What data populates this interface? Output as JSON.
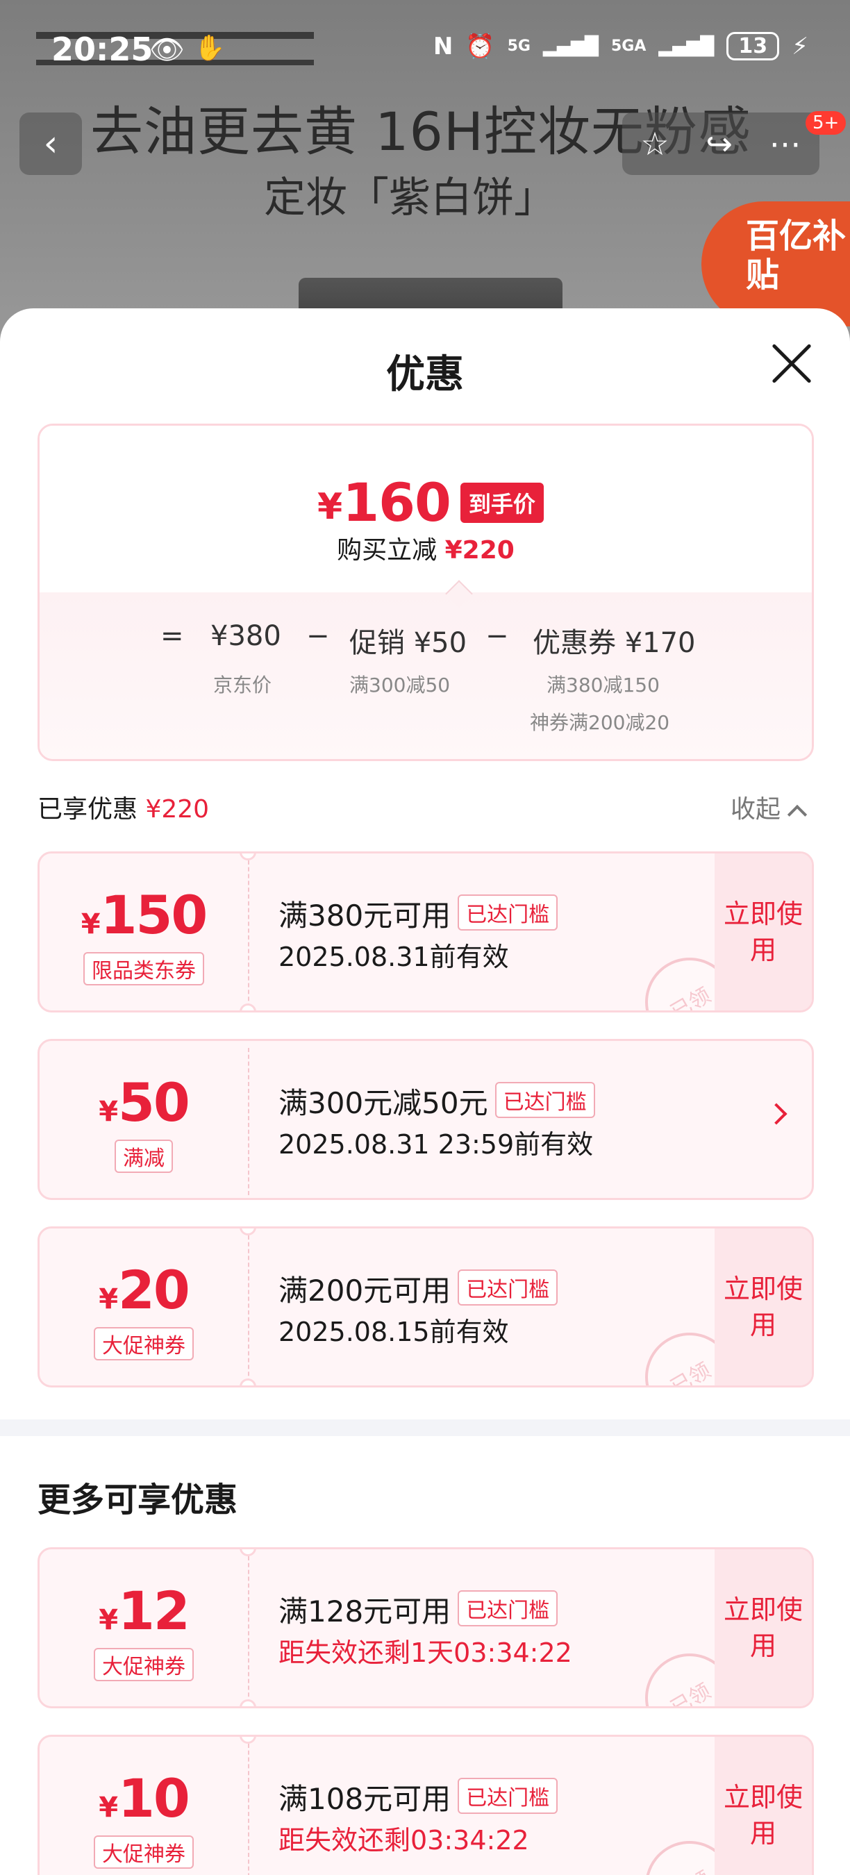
{
  "status_bar": {
    "time": "20:25",
    "signal1": "5G",
    "signal2": "5GA",
    "battery": "13"
  },
  "background": {
    "banner_title": "去油更去黄 16H控妆无粉感",
    "banner_subtitle": "定妆「紫白饼」",
    "subsidy_badge": "百亿补贴",
    "badge_count": "5+"
  },
  "sheet": {
    "title": "优惠",
    "summary": {
      "yen": "¥",
      "final_price": "160",
      "price_tag": "到手价",
      "instant_cut_label": "购买立减",
      "instant_cut_value": "¥220",
      "formula": {
        "equals": "=",
        "jd_price": "¥380",
        "jd_price_label": "京东价",
        "minus1": "−",
        "promo": "促销 ¥50",
        "promo_detail": "满300减50",
        "minus2": "−",
        "coupon": "优惠券 ¥170",
        "coupon_detail1": "满380减150",
        "coupon_detail2": "神券满200减20"
      }
    },
    "enjoyed_label": "已享优惠",
    "enjoyed_value": "¥220",
    "collapse_label": "收起",
    "coupons": [
      {
        "yen": "¥",
        "amount": "150",
        "type": "限品类东券",
        "condition": "满380元可用",
        "threshold": "已达门槛",
        "validity": "2025.08.31前有效",
        "action": "立即使用",
        "stamp": "已领"
      },
      {
        "yen": "¥",
        "amount": "50",
        "type": "满减",
        "condition": "满300元减50元",
        "threshold": "已达门槛",
        "validity": "2025.08.31 23:59前有效"
      },
      {
        "yen": "¥",
        "amount": "20",
        "type": "大促神券",
        "condition": "满200元可用",
        "threshold": "已达门槛",
        "validity": "2025.08.15前有效",
        "action": "立即使用",
        "stamp": "已领"
      }
    ],
    "more_title": "更多可享优惠",
    "more_coupons": [
      {
        "yen": "¥",
        "amount": "12",
        "type": "大促神券",
        "condition": "满128元可用",
        "threshold": "已达门槛",
        "validity": "距失效还剩1天03:34:22",
        "action": "立即使用",
        "stamp": "已领"
      },
      {
        "yen": "¥",
        "amount": "10",
        "type": "大促神券",
        "condition": "满108元可用",
        "threshold": "已达门槛",
        "validity": "距失效还剩03:34:22",
        "action": "立即使用",
        "stamp": "已领"
      }
    ],
    "colors": {
      "accent": "#e8213a",
      "border": "#fcd6dc",
      "card_bg": "#fff5f7"
    }
  }
}
